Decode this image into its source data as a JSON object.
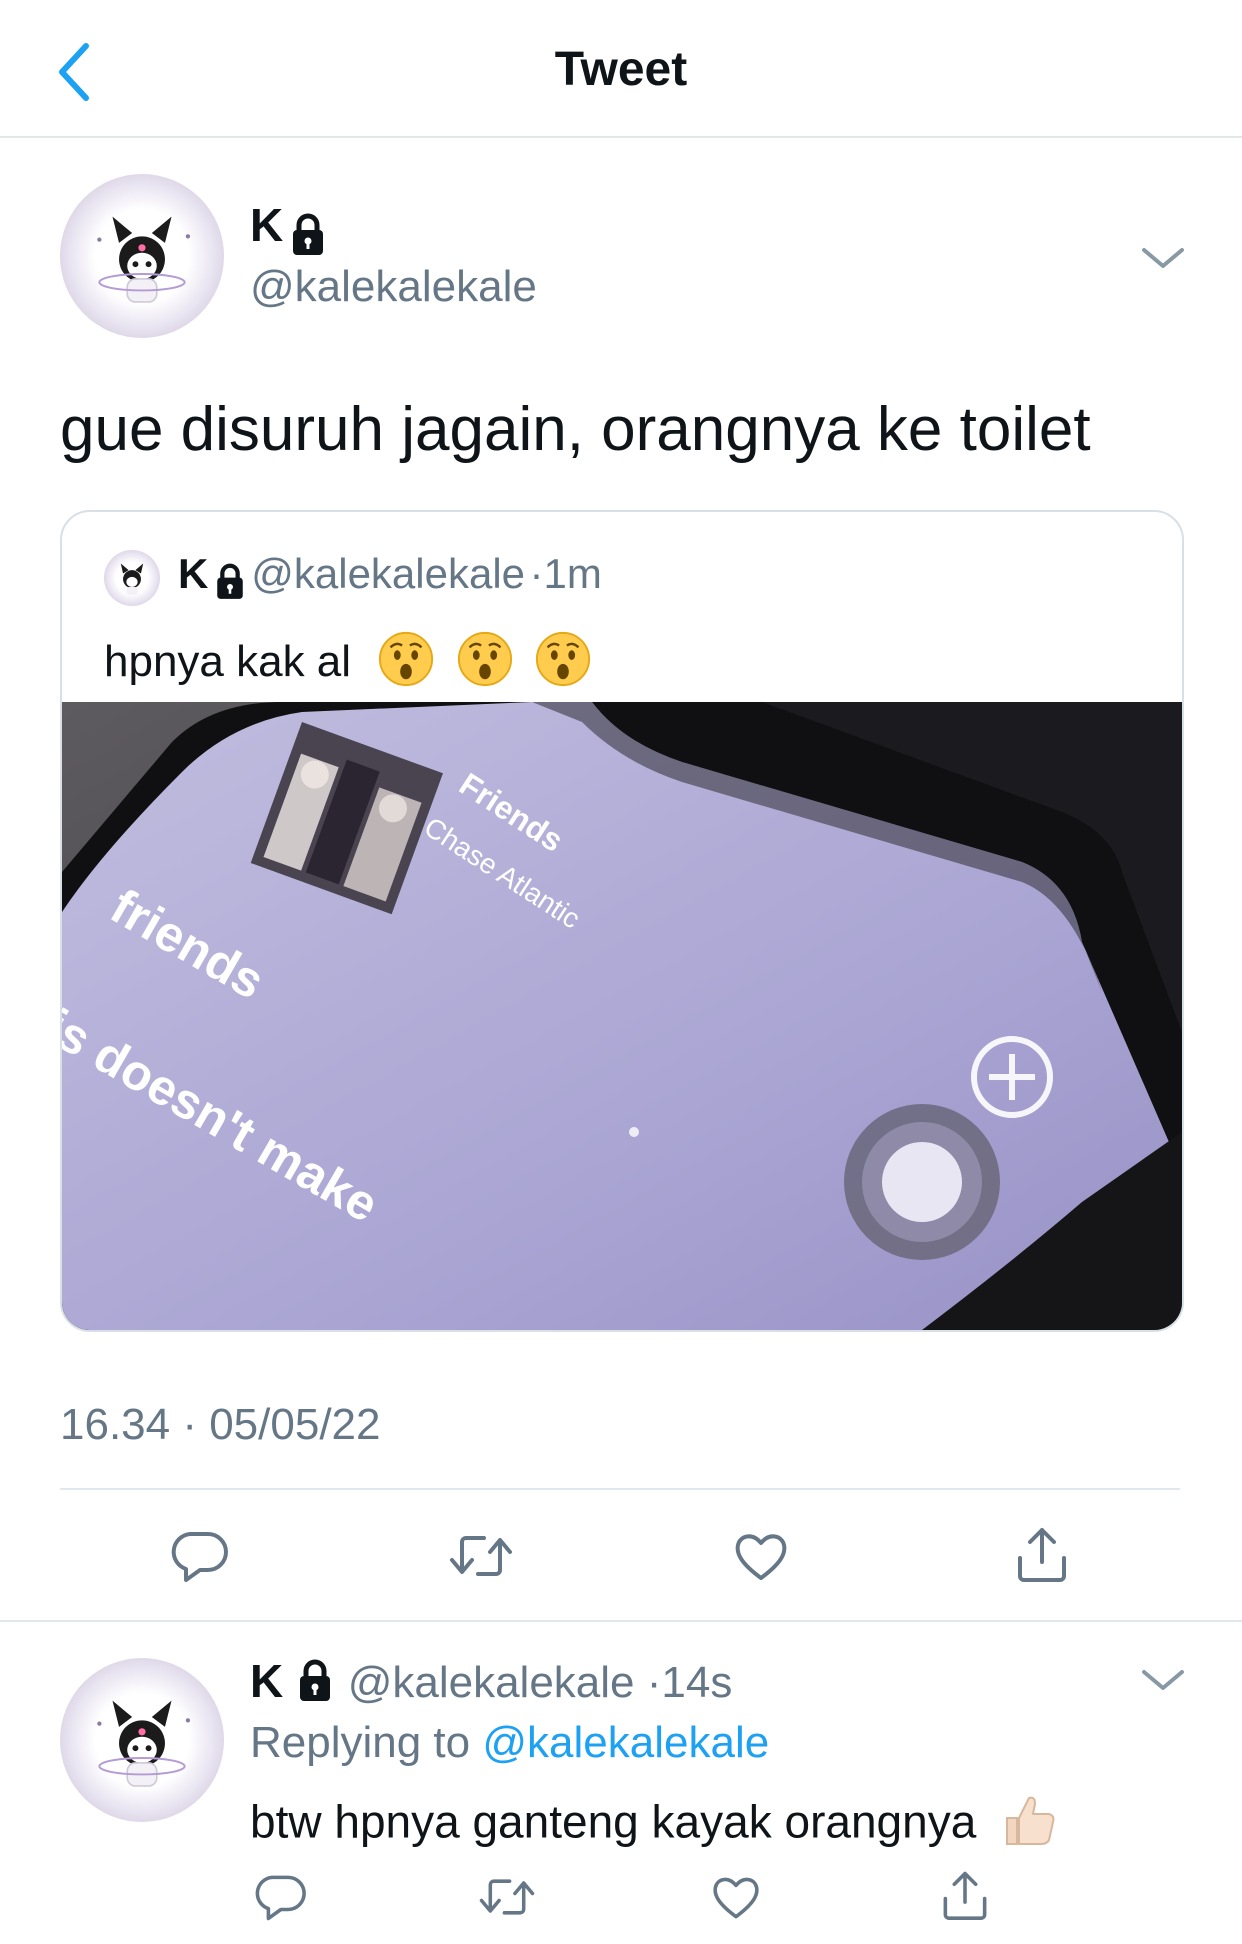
{
  "header": {
    "title": "Tweet",
    "back_icon": "chevron-left-icon"
  },
  "tweet": {
    "name": "K",
    "handle": "@kalekalekale",
    "text": "gue disuruh jagain, orangnya ke toilet",
    "timestamp": "16.34 · 05/05/22",
    "quote": {
      "name": "K",
      "handle": "@kalekalekale",
      "separator": "·",
      "time": "1m",
      "text": "hpnya kak al",
      "emojis": [
        "hushed-face-emoji",
        "hushed-face-emoji",
        "hushed-face-emoji"
      ],
      "media": {
        "song_title": "Friends",
        "artist": "Chase Atlantic",
        "lyric_1": "friends",
        "lyric_2": "is doesn't make"
      }
    },
    "actions": [
      "reply-icon",
      "retweet-icon",
      "like-icon",
      "share-icon"
    ]
  },
  "reply": {
    "name": "K",
    "handle": "@kalekalekale",
    "separator": "·",
    "time": "14s",
    "replying_prefix": "Replying to",
    "replying_handle": "@kalekalekale",
    "text": "btw hpnya ganteng kayak orangnya",
    "emoji": "thumbs-up-emoji",
    "actions": [
      "reply-icon",
      "retweet-icon",
      "like-icon",
      "share-icon"
    ]
  },
  "colors": {
    "accent": "#1da1f2",
    "secondary_text": "#657786",
    "divider": "#e1e8ed"
  }
}
